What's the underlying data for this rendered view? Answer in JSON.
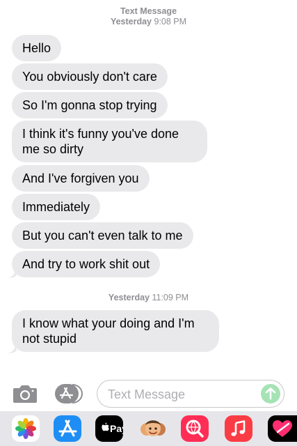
{
  "conversation": {
    "header": {
      "service": "Text Message",
      "day": "Yesterday",
      "time": "9:08 PM"
    },
    "group1": [
      "Hello",
      "You obviously don't care",
      "So I'm gonna stop trying",
      "I think it's funny you've done me so dirty",
      "And I've forgiven you",
      "Immediately",
      "But you can't even talk to me",
      "And try to work shit out"
    ],
    "divider": {
      "day": "Yesterday",
      "time": "11:09 PM"
    },
    "group2": [
      "I know what your doing and I'm not stupid"
    ]
  },
  "composer": {
    "placeholder": "Text Message"
  },
  "app_drawer": {
    "apps": [
      "photos-app",
      "app-store-app",
      "apple-pay-app",
      "memoji-app",
      "web-search-app",
      "music-app",
      "digital-touch-app"
    ],
    "apple_pay_label": "Pay"
  },
  "colors": {
    "incoming_bubble": "#e9e9eb",
    "timestamp_gray": "#8e8e93",
    "send_button_disabled": "#a5e3b4",
    "app_drawer_bg": "#e6e6ea"
  }
}
